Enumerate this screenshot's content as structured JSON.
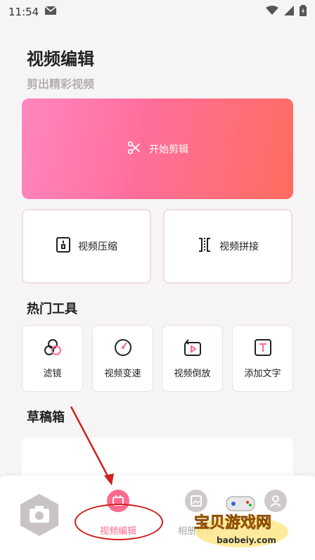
{
  "status": {
    "time": "11:54"
  },
  "page": {
    "title": "视频编辑",
    "subtitle": "剪出精彩视频"
  },
  "hero": {
    "label": "开始剪辑"
  },
  "cards": [
    {
      "label": "视频压缩"
    },
    {
      "label": "视频拼接"
    }
  ],
  "sections": {
    "hot_tools": "热门工具",
    "drafts": "草稿箱"
  },
  "tools": [
    {
      "label": "滤镜"
    },
    {
      "label": "视频变速"
    },
    {
      "label": "视频倒放"
    },
    {
      "label": "添加文字"
    }
  ],
  "nav": {
    "video_edit": "视频编辑",
    "album_manage": "相册管理"
  },
  "watermark": {
    "brand": "宝贝游戏网",
    "url": "baobeiy.com"
  },
  "colors": {
    "accent": "#ff6a8c",
    "hero_start": "#ff86c0",
    "hero_end": "#ff6d5f",
    "annotation": "#d02020"
  }
}
